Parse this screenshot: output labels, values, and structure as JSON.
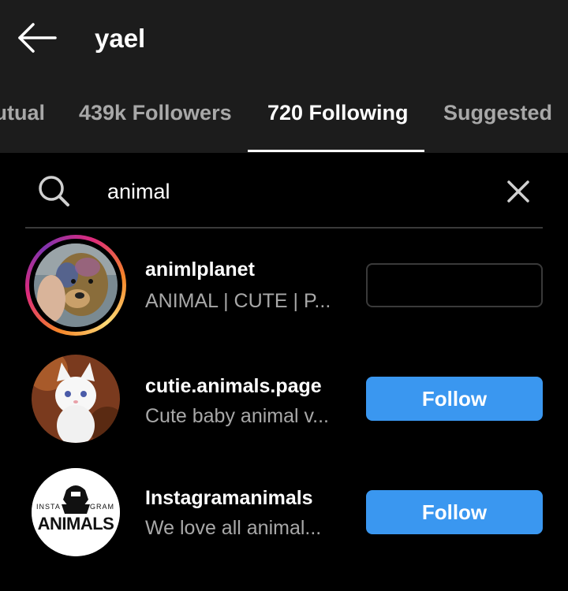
{
  "header": {
    "title": "yael",
    "back_icon": "arrow-left-icon"
  },
  "tabs": [
    {
      "label": "Mutual",
      "active": false
    },
    {
      "label": "439k Followers",
      "active": false
    },
    {
      "label": "720 Following",
      "active": true
    },
    {
      "label": "Suggested",
      "active": false
    }
  ],
  "search": {
    "value": "animal",
    "search_icon": "search-icon",
    "clear_icon": "close-icon"
  },
  "results": [
    {
      "username": "animlplanet",
      "description": "ANIMAL | CUTE | P...",
      "button": "",
      "has_story": true
    },
    {
      "username": "cutie.animals.page",
      "description": "Cute baby animal v...",
      "button": "Follow",
      "has_story": false
    },
    {
      "username": "Instagramanimals",
      "description": "We love all animal...",
      "button": "Follow",
      "has_story": false,
      "logo_text": {
        "top_left": "INSTA",
        "top_right": "GRAM",
        "main": "ANIMALS"
      }
    }
  ],
  "colors": {
    "header_bg": "#1c1c1c",
    "background": "#000000",
    "follow_button": "#3a97f0",
    "muted_text": "#a8a8a8"
  }
}
